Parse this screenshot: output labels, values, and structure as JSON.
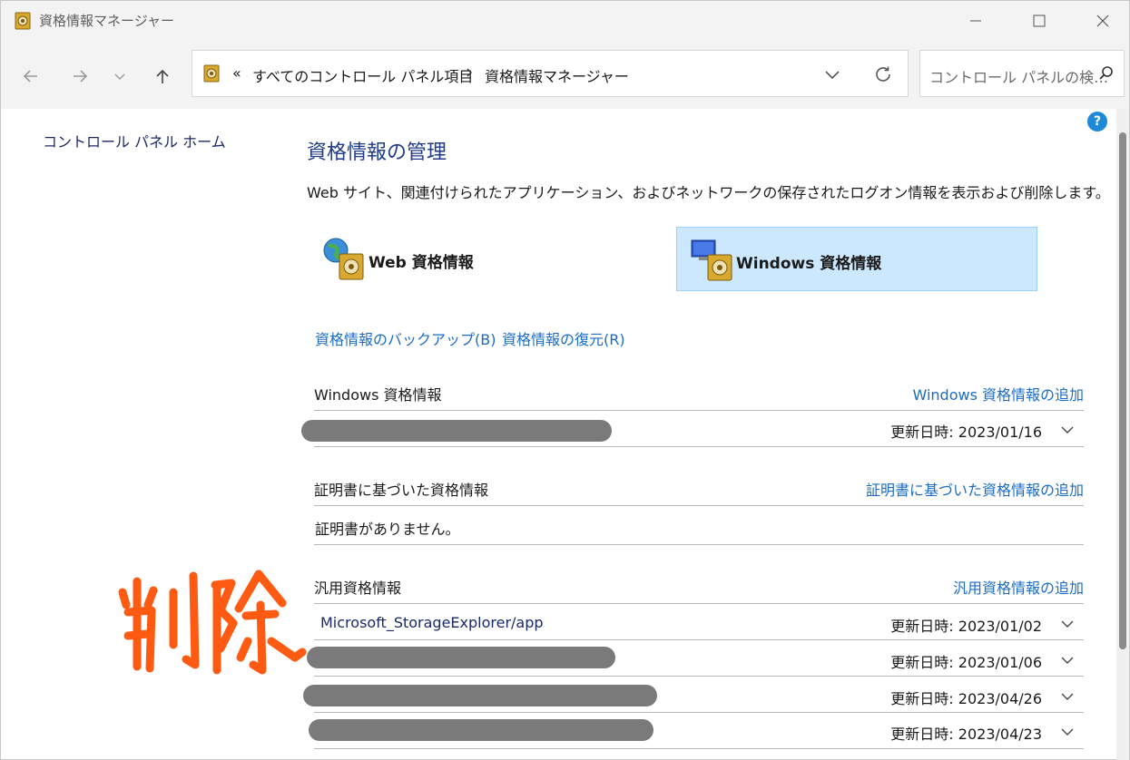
{
  "window": {
    "title": "資格情報マネージャー"
  },
  "address": {
    "overflow": "«",
    "crumbs": [
      "すべてのコントロール パネル項目",
      "資格情報マネージャー"
    ],
    "search_placeholder": "コントロール パネルの検…"
  },
  "sidebar": {
    "home_link": "コントロール パネル ホーム"
  },
  "main": {
    "title": "資格情報の管理",
    "description": "Web サイト、関連付けられたアプリケーション、およびネットワークの保存されたログオン情報を表示および削除します。",
    "tiles": {
      "web": "Web 資格情報",
      "windows": "Windows 資格情報"
    },
    "backup_link": "資格情報のバックアップ(B)",
    "restore_link": "資格情報の復元(R)"
  },
  "sections": {
    "windows": {
      "title": "Windows 資格情報",
      "add": "Windows 資格情報の追加",
      "rows": [
        {
          "date_label": "更新日時:",
          "date": "2023/01/16"
        }
      ]
    },
    "certificate": {
      "title": "証明書に基づいた資格情報",
      "add": "証明書に基づいた資格情報の追加",
      "empty": "証明書がありません。"
    },
    "generic": {
      "title": "汎用資格情報",
      "add": "汎用資格情報の追加",
      "rows": [
        {
          "name": "Microsoft_StorageExplorer/app",
          "date_label": "更新日時:",
          "date": "2023/01/02"
        },
        {
          "name": "",
          "date_label": "更新日時:",
          "date": "2023/01/06"
        },
        {
          "name": "",
          "date_label": "更新日時:",
          "date": "2023/04/26"
        },
        {
          "name": "",
          "date_label": "更新日時:",
          "date": "2023/04/23"
        }
      ]
    }
  },
  "annotation": {
    "handwritten": "削除",
    "color": "#ff5a12"
  },
  "colors": {
    "link": "#1a6cc6",
    "title": "#1e3b8a",
    "selected_tile": "#cce8ff"
  }
}
